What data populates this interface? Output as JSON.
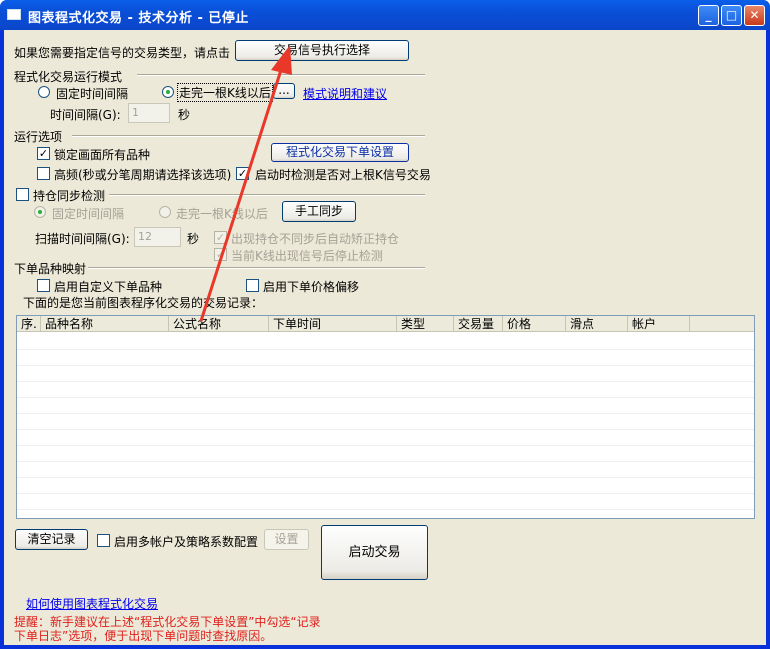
{
  "window": {
    "title": "图表程式化交易 - 技术分析 - 已停止"
  },
  "signal": {
    "prompt": "如果您需要指定信号的交易类型，请点击",
    "button": "交易信号执行选择"
  },
  "run_mode": {
    "group_label": "程式化交易运行模式",
    "option_fixed": "固定时间间隔",
    "option_bar": "走完一根K线以后",
    "browse_label": "...",
    "help_link": "模式说明和建议",
    "interval_label": "时间间隔(G):",
    "interval_value": "1",
    "interval_unit": "秒"
  },
  "run_options": {
    "group_label": "运行选项",
    "lock_all": "锁定画面所有品种",
    "order_settings_button": "程式化交易下单设置",
    "high_freq": "高频(秒或分笔周期请选择该选项)",
    "check_on_start": "启动时检测是否对上根K信号交易"
  },
  "position_sync": {
    "group_label": "持仓同步检测",
    "option_fixed": "固定时间间隔",
    "option_bar": "走完一根K线以后",
    "manual_sync_button": "手工同步",
    "scan_label": "扫描时间间隔(G):",
    "scan_value": "12",
    "scan_unit": "秒",
    "auto_correct": "出现持仓不同步后自动矫正持仓",
    "stop_on_signal": "当前K线出现信号后停止检测"
  },
  "order_mapping": {
    "group_label": "下单品种映射",
    "custom_symbol": "启用自定义下单品种",
    "price_offset": "启用下单价格偏移"
  },
  "records": {
    "caption": "下面的是您当前图表程序化交易的交易记录：",
    "columns": [
      "序.",
      "品种名称",
      "公式名称",
      "下单时间",
      "类型",
      "交易量",
      "价格",
      "滑点",
      "帐户"
    ]
  },
  "footer": {
    "clear_button": "清空记录",
    "multi_account": "启用多帐户及策略系数配置",
    "settings_button": "设置",
    "start_button": "启动交易",
    "help_link": "如何使用图表程式化交易",
    "tip_line1": "提醒：新手建议在上述“程式化交易下单设置”中勾选“记录",
    "tip_line2": "下单日志”选项，便于出现下单问题时查找原因。"
  },
  "colors": {
    "accent_arrow": "#e8382a",
    "title_bar": "#0a4fd8",
    "tip_text": "#e0201c"
  }
}
